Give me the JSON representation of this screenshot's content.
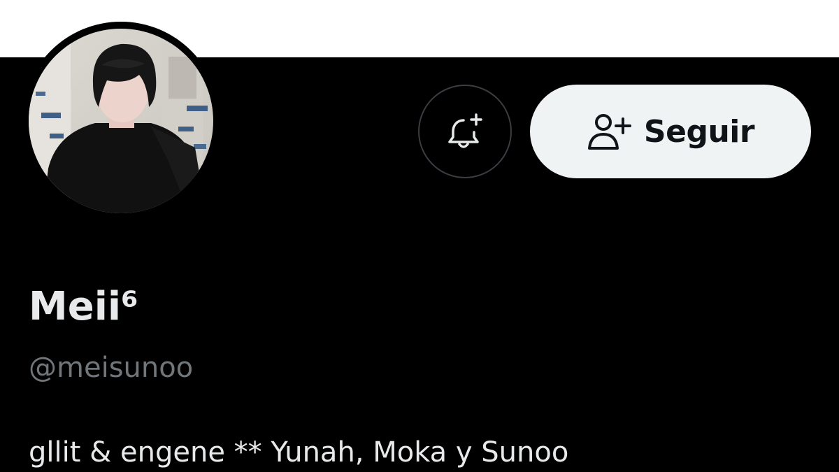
{
  "profile": {
    "display_name": "Meii⁶",
    "handle": "@meisunoo",
    "bio": "gllit & engene ** Yunah, Moka y Sunoo",
    "avatar_icon": "profile-photo"
  },
  "actions": {
    "notify_icon": "bell-plus-icon",
    "follow_icon": "user-plus-icon",
    "follow_label": "Seguir"
  },
  "colors": {
    "background": "#000000",
    "banner": "#ffffff",
    "primary_text": "#e7e9ea",
    "secondary_text": "#71767b",
    "follow_button_bg": "#eff3f4",
    "follow_button_text": "#0f1419",
    "outline": "#3a3d41"
  }
}
